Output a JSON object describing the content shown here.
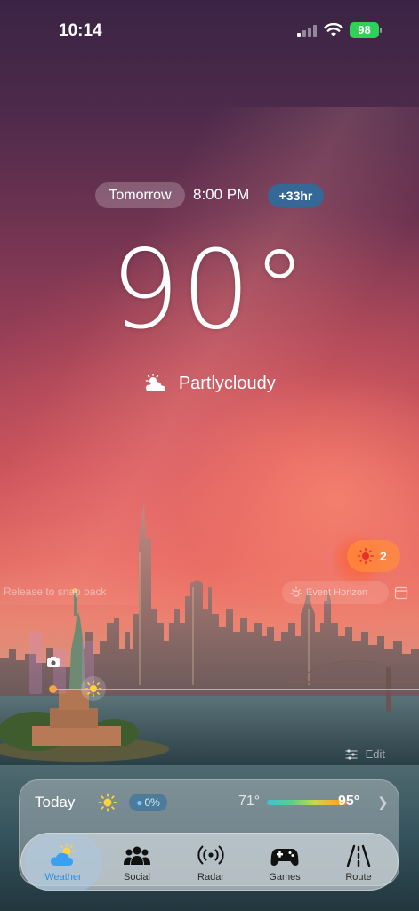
{
  "status_bar": {
    "time": "10:14",
    "battery": "98"
  },
  "forecast": {
    "day_label": "Tomorrow",
    "time": "8:00 PM",
    "offset": "+33hr",
    "temperature": "90°",
    "condition": "Partlycloudy",
    "condition_icon": "partly-cloudy-icon"
  },
  "sun_badge": {
    "icon": "sun-icon",
    "count": "2"
  },
  "timeline": {
    "hint": "Release to snap back",
    "event_label": "Event Horizon"
  },
  "edit_label": "Edit",
  "today": {
    "label": "Today",
    "icon": "sun-icon",
    "precip": "0%",
    "low": "71°",
    "high": "95°"
  },
  "tabs": [
    {
      "label": "Weather",
      "icon": "weather-icon",
      "active": true
    },
    {
      "label": "Social",
      "icon": "people-icon",
      "active": false
    },
    {
      "label": "Radar",
      "icon": "radar-icon",
      "active": false
    },
    {
      "label": "Games",
      "icon": "gamepad-icon",
      "active": false
    },
    {
      "label": "Route",
      "icon": "road-icon",
      "active": false
    }
  ],
  "colors": {
    "accent": "#2a8fe0",
    "battery": "#30d158",
    "offset_pill": "#286ea0",
    "sun_badge": "#ff8c3c"
  }
}
